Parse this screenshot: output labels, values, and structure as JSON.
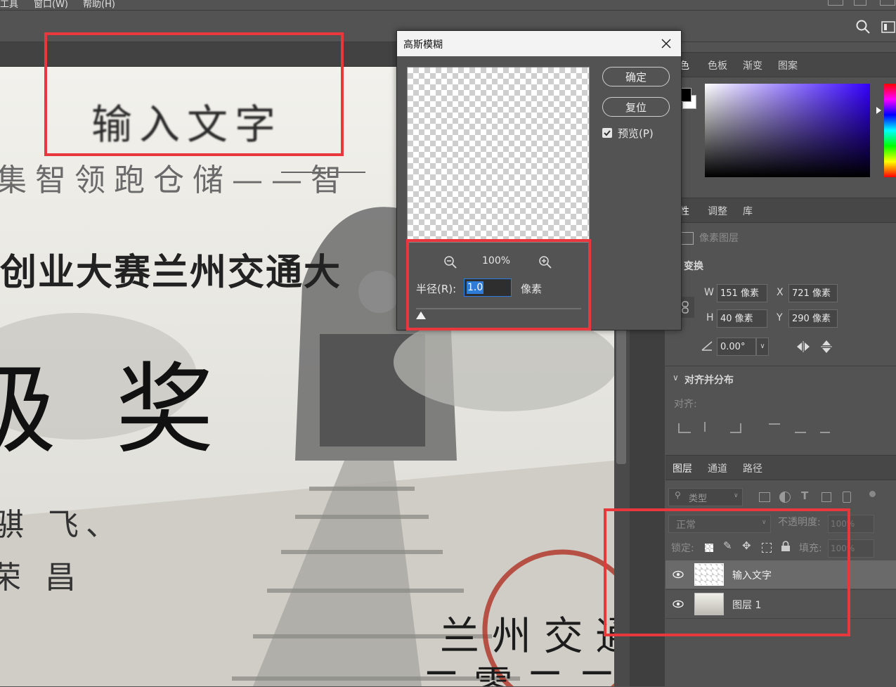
{
  "menubar": {
    "items": [
      "工具",
      "窗口(W)",
      "帮助(H)"
    ]
  },
  "canvas": {
    "text_box": "输入文字",
    "line1": "集智领跑仓储——智",
    "line2": "创业大赛兰州交通大",
    "line3": "级 奖",
    "line4": "骐 飞、",
    "line5": "荣 昌",
    "line6": "兰 州 交 通",
    "line7": "二 零 二 二"
  },
  "dialog": {
    "title": "高斯模糊",
    "ok_label": "确定",
    "reset_label": "复位",
    "preview_label": "预览(P)",
    "zoom_level": "100%",
    "radius_label": "半径(R):",
    "radius_value": "1.0",
    "radius_unit": "像素",
    "slider_fraction": 0.01
  },
  "color_panel": {
    "tabs": [
      "颜色",
      "色板",
      "渐变",
      "图案"
    ],
    "visible_first_tab": "色",
    "hue_color": "#3300ff"
  },
  "props_panel": {
    "tabs": [
      "属性",
      "调整",
      "库"
    ],
    "visible_first_tab": "性",
    "layer_type": "像素图层",
    "transform_label": "变换",
    "w_label": "W",
    "w_value": "151 像素",
    "x_label": "X",
    "x_value": "721 像素",
    "h_label": "H",
    "h_value": "40 像素",
    "y_label": "Y",
    "y_value": "290 像素",
    "angle_value": "0.00°",
    "align_label": "对齐并分布",
    "align_sub": "对齐:"
  },
  "layers_panel": {
    "tabs": [
      "图层",
      "通道",
      "路径"
    ],
    "filter_placeholder": "类型",
    "blend_mode": "正常",
    "opacity_label": "不透明度:",
    "opacity_value": "100%",
    "lock_label": "锁定:",
    "fill_label": "填充:",
    "fill_value": "100%",
    "layers": [
      {
        "name": "输入文字",
        "selected": true
      },
      {
        "name": "图层 1",
        "selected": false
      }
    ]
  }
}
